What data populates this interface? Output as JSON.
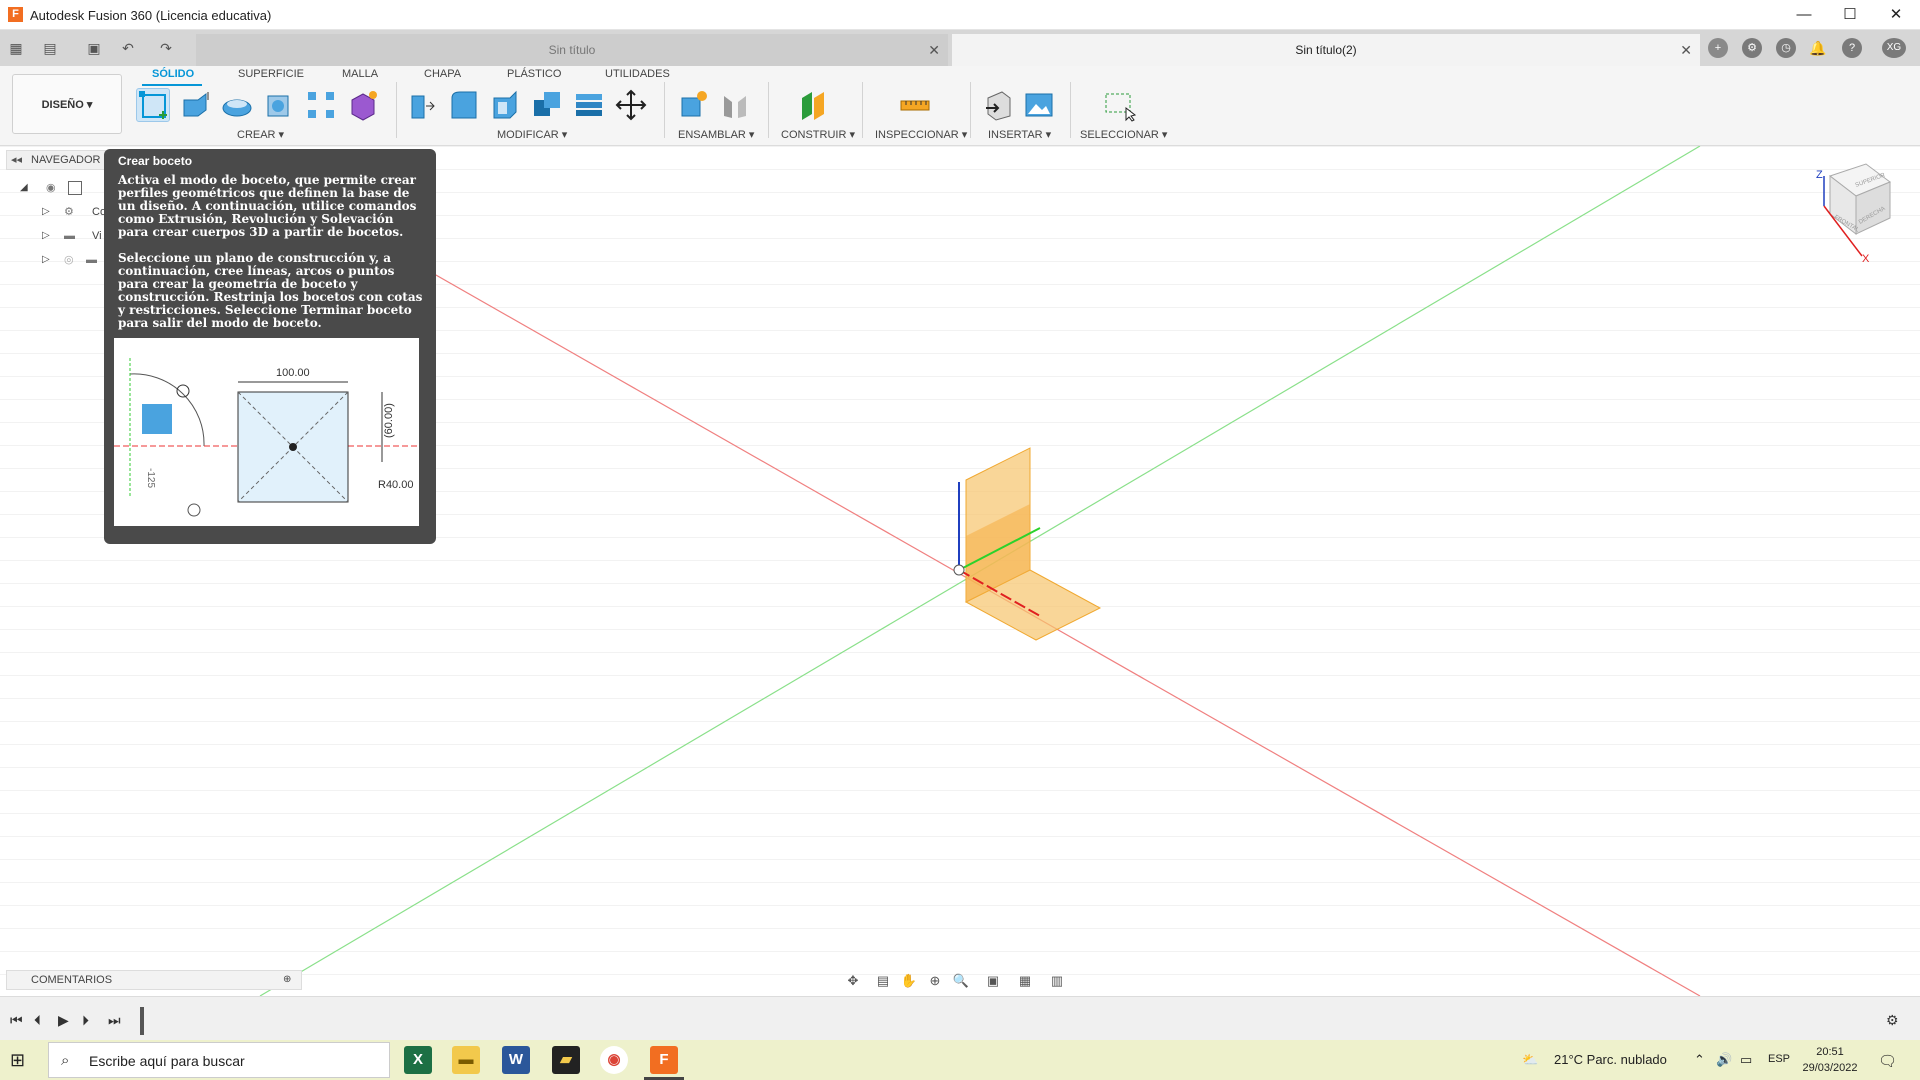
{
  "window": {
    "title": "Autodesk Fusion 360 (Licencia educativa)",
    "app_icon_letter": "F",
    "minimize": "—",
    "maximize": "☐",
    "close": "✕"
  },
  "tabs": [
    {
      "label": "Sin título",
      "close": "✕",
      "active": false
    },
    {
      "label": "Sin título(2)",
      "close": "✕",
      "active": true
    }
  ],
  "user_initials": "XG",
  "toolbar": {
    "workspace": "DISEÑO ▾",
    "workspace_tabs": [
      "SÓLIDO",
      "SUPERFICIE",
      "MALLA",
      "CHAPA",
      "PLÁSTICO",
      "UTILIDADES"
    ],
    "groups": [
      "CREAR ▾",
      "MODIFICAR ▾",
      "ENSAMBLAR ▾",
      "CONSTRUIR ▾",
      "INSPECCIONAR ▾",
      "INSERTAR ▾",
      "SELECCIONAR ▾"
    ]
  },
  "navigator": {
    "title": "NAVEGADOR",
    "rows": [
      "",
      "Co",
      "Vi",
      ""
    ]
  },
  "tooltip": {
    "title": "Crear boceto",
    "para1": "Activa el modo de boceto, que permite crear perfiles geométricos que definen la base de un diseño. A continuación, utilice comandos como Extrusión, Revolución y Solevación para crear cuerpos 3D a partir de bocetos.",
    "para2": "Seleccione un plano de construcción y, a continuación, cree líneas, arcos o puntos para crear la geometría de boceto y construcción. Restrinja los bocetos con cotas y restricciones. Seleccione Terminar boceto para salir del modo de boceto.",
    "dim_width": "100.00",
    "dim_height": "(60.00)",
    "dim_radius": "R40.00",
    "dim_angle": "-125"
  },
  "viewcube": {
    "z": "Z",
    "x": "X",
    "top": "SUPERIOR",
    "front": "FRONTAL",
    "right": "DERECHA"
  },
  "comments_label": "COMENTARIOS",
  "taskbar": {
    "search_placeholder": "Escribe aquí para buscar",
    "weather": "21°C  Parc. nublado",
    "lang": "ESP",
    "time": "20:51",
    "date": "29/03/2022"
  }
}
